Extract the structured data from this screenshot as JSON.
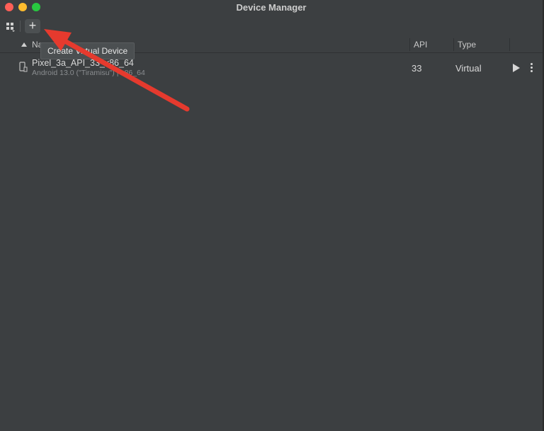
{
  "window": {
    "title": "Device Manager"
  },
  "toolbar": {
    "add_label": "+",
    "add_tooltip": "Create Virtual Device"
  },
  "table": {
    "columns": {
      "name": "Na",
      "api": "API",
      "type": "Type"
    },
    "rows": [
      {
        "name": "Pixel_3a_API_33_x86_64",
        "subtitle": "Android 13.0 (\"Tiramisu\") | x86_64",
        "api": "33",
        "type": "Virtual"
      }
    ]
  },
  "colors": {
    "background": "#3c3f41",
    "arrow": "#e53a2e",
    "close": "#ff5f57",
    "minimize": "#febc2e",
    "maximize": "#28c840"
  },
  "icons": [
    "grid-menu-icon",
    "add-icon",
    "sort-ascending-icon",
    "phone-icon",
    "play-icon",
    "more-vertical-icon",
    "annotation-arrow-icon"
  ]
}
